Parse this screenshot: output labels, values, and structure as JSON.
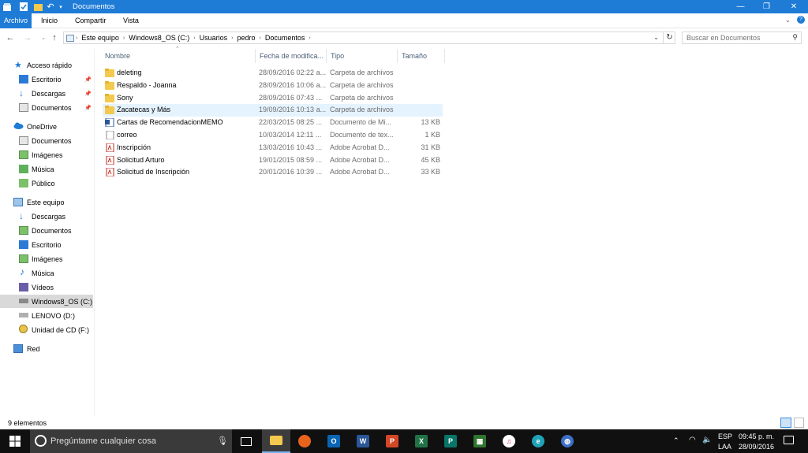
{
  "window": {
    "title": "Documentos"
  },
  "ribbon": {
    "tabs": [
      "Archivo",
      "Inicio",
      "Compartir",
      "Vista"
    ]
  },
  "address": {
    "crumbs": [
      "Este equipo",
      "Windows8_OS (C:)",
      "Usuarios",
      "pedro",
      "Documentos"
    ]
  },
  "search": {
    "placeholder": "Buscar en Documentos"
  },
  "sidebar": {
    "quick_access": "Acceso rápido",
    "quick_items": [
      "Escritorio",
      "Descargas",
      "Documentos"
    ],
    "onedrive": "OneDrive",
    "onedrive_items": [
      "Documentos",
      "Imágenes",
      "Música",
      "Público"
    ],
    "this_pc": "Este equipo",
    "pc_items": [
      "Descargas",
      "Documentos",
      "Escritorio",
      "Imágenes",
      "Música",
      "Vídeos",
      "Windows8_OS (C:)"
    ],
    "drives": [
      "LENOVO (D:)",
      "Unidad de CD (F:)"
    ],
    "network": "Red"
  },
  "columns": {
    "name": "Nombre",
    "date": "Fecha de modifica...",
    "type": "Tipo",
    "size": "Tamaño"
  },
  "files": [
    {
      "name": "deleting",
      "date": "28/09/2016 02:22 a...",
      "type": "Carpeta de archivos",
      "size": "",
      "kind": "folder"
    },
    {
      "name": "Respaldo - Joanna",
      "date": "28/09/2016 10:06 a...",
      "type": "Carpeta de archivos",
      "size": "",
      "kind": "folder"
    },
    {
      "name": "Sony",
      "date": "28/09/2016 07:43 ...",
      "type": "Carpeta de archivos",
      "size": "",
      "kind": "folder"
    },
    {
      "name": "Zacatecas y Más",
      "date": "19/09/2016 10:13 a...",
      "type": "Carpeta de archivos",
      "size": "",
      "kind": "folder"
    },
    {
      "name": "Cartas de RecomendacionMEMO",
      "date": "22/03/2015 08:25 ...",
      "type": "Documento de Mi...",
      "size": "13 KB",
      "kind": "word"
    },
    {
      "name": "correo",
      "date": "10/03/2014 12:11 ...",
      "type": "Documento de tex...",
      "size": "1 KB",
      "kind": "text"
    },
    {
      "name": "Inscripción",
      "date": "13/03/2016 10:43 ...",
      "type": "Adobe Acrobat D...",
      "size": "31 KB",
      "kind": "pdf"
    },
    {
      "name": "Solicitud Arturo",
      "date": "19/01/2015 08:59 ...",
      "type": "Adobe Acrobat D...",
      "size": "45 KB",
      "kind": "pdf"
    },
    {
      "name": "Solicitud de Inscripción",
      "date": "20/01/2016 10:39 ...",
      "type": "Adobe Acrobat D...",
      "size": "33 KB",
      "kind": "pdf"
    }
  ],
  "status": {
    "count": "9 elementos"
  },
  "taskbar": {
    "search_placeholder": "Pregúntame cualquier cosa",
    "lang": "ESP",
    "layout": "LAA",
    "time": "09:45 p. m.",
    "date": "28/09/2016"
  },
  "colors": {
    "accent": "#1e7bd6",
    "folder": "#f3c94e",
    "pdf": "#c0281d",
    "selection": "#e5f3ff"
  }
}
